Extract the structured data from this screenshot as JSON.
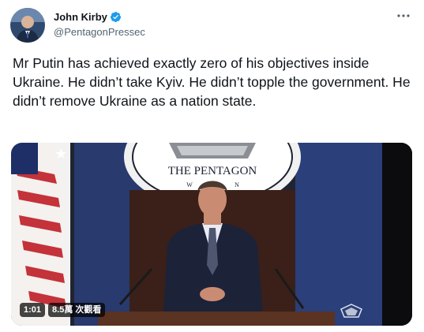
{
  "author": {
    "display_name": "John Kirby",
    "handle": "@PentagonPressec",
    "verified": true
  },
  "tweet": {
    "text": "Mr Putin has achieved exactly zero of his objectives inside Ukraine. He didn’t take Kyiv. He didn’t topple the government. He didn’t remove Ukraine as a nation state."
  },
  "video": {
    "seal_text": "THE PENTAGON",
    "seal_letter_w": "W",
    "seal_letter_n": "N",
    "duration": "1:01",
    "views": "8.5萬 次觀看"
  },
  "icons": {
    "verified": "verified-badge-icon",
    "more": "more-horizontal-icon",
    "watermark": "pentagon-watermark-icon"
  },
  "colors": {
    "accent": "#1d9bf0",
    "text_primary": "#0f1419",
    "text_secondary": "#536471"
  }
}
